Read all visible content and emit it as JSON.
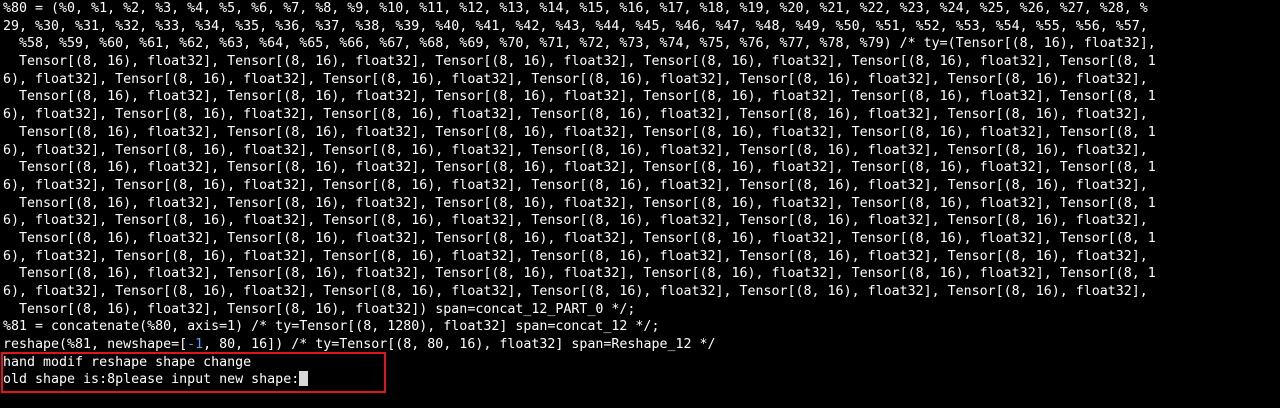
{
  "terminal": {
    "lines": [
      "%80 = (%0, %1, %2, %3, %4, %5, %6, %7, %8, %9, %10, %11, %12, %13, %14, %15, %16, %17, %18, %19, %20, %21, %22, %23, %24, %25, %26, %27, %28, %",
      "29, %30, %31, %32, %33, %34, %35, %36, %37, %38, %39, %40, %41, %42, %43, %44, %45, %46, %47, %48, %49, %50, %51, %52, %53, %54, %55, %56, %57,",
      "  %58, %59, %60, %61, %62, %63, %64, %65, %66, %67, %68, %69, %70, %71, %72, %73, %74, %75, %76, %77, %78, %79) /* ty=(Tensor[(8, 16), float32],",
      "  Tensor[(8, 16), float32], Tensor[(8, 16), float32], Tensor[(8, 16), float32], Tensor[(8, 16), float32], Tensor[(8, 16), float32], Tensor[(8, 1",
      "6), float32], Tensor[(8, 16), float32], Tensor[(8, 16), float32], Tensor[(8, 16), float32], Tensor[(8, 16), float32], Tensor[(8, 16), float32],",
      "  Tensor[(8, 16), float32], Tensor[(8, 16), float32], Tensor[(8, 16), float32], Tensor[(8, 16), float32], Tensor[(8, 16), float32], Tensor[(8, 1",
      "6), float32], Tensor[(8, 16), float32], Tensor[(8, 16), float32], Tensor[(8, 16), float32], Tensor[(8, 16), float32], Tensor[(8, 16), float32],",
      "  Tensor[(8, 16), float32], Tensor[(8, 16), float32], Tensor[(8, 16), float32], Tensor[(8, 16), float32], Tensor[(8, 16), float32], Tensor[(8, 1",
      "6), float32], Tensor[(8, 16), float32], Tensor[(8, 16), float32], Tensor[(8, 16), float32], Tensor[(8, 16), float32], Tensor[(8, 16), float32],",
      "  Tensor[(8, 16), float32], Tensor[(8, 16), float32], Tensor[(8, 16), float32], Tensor[(8, 16), float32], Tensor[(8, 16), float32], Tensor[(8, 1",
      "6), float32], Tensor[(8, 16), float32], Tensor[(8, 16), float32], Tensor[(8, 16), float32], Tensor[(8, 16), float32], Tensor[(8, 16), float32],",
      "  Tensor[(8, 16), float32], Tensor[(8, 16), float32], Tensor[(8, 16), float32], Tensor[(8, 16), float32], Tensor[(8, 16), float32], Tensor[(8, 1",
      "6), float32], Tensor[(8, 16), float32], Tensor[(8, 16), float32], Tensor[(8, 16), float32], Tensor[(8, 16), float32], Tensor[(8, 16), float32],",
      "  Tensor[(8, 16), float32], Tensor[(8, 16), float32], Tensor[(8, 16), float32], Tensor[(8, 16), float32], Tensor[(8, 16), float32], Tensor[(8, 1",
      "6), float32], Tensor[(8, 16), float32], Tensor[(8, 16), float32], Tensor[(8, 16), float32], Tensor[(8, 16), float32], Tensor[(8, 16), float32],",
      "  Tensor[(8, 16), float32], Tensor[(8, 16), float32], Tensor[(8, 16), float32], Tensor[(8, 16), float32], Tensor[(8, 16), float32], Tensor[(8, 1",
      "6), float32], Tensor[(8, 16), float32], Tensor[(8, 16), float32], Tensor[(8, 16), float32], Tensor[(8, 16), float32], Tensor[(8, 16), float32],",
      "  Tensor[(8, 16), float32], Tensor[(8, 16), float32]) span=concat_12_PART_0 */;",
      "%81 = concatenate(%80, axis=1) /* ty=Tensor[(8, 1280), float32] span=concat_12 */;"
    ],
    "reshape_line": {
      "before": "reshape(%81, newshape=[",
      "neg": "-1",
      "after": ", 80, 16]) /* ty=Tensor[(8, 80, 16), float32] span=Reshape_12 */"
    },
    "prompt_line_1": "hand modif reshape shape change",
    "prompt_line_2": "old shape is:8please input new shape:",
    "colors": {
      "background": "#000000",
      "text": "#ffffff",
      "negative_number": "#4aa8ff",
      "highlight_border": "#e0141c"
    }
  }
}
